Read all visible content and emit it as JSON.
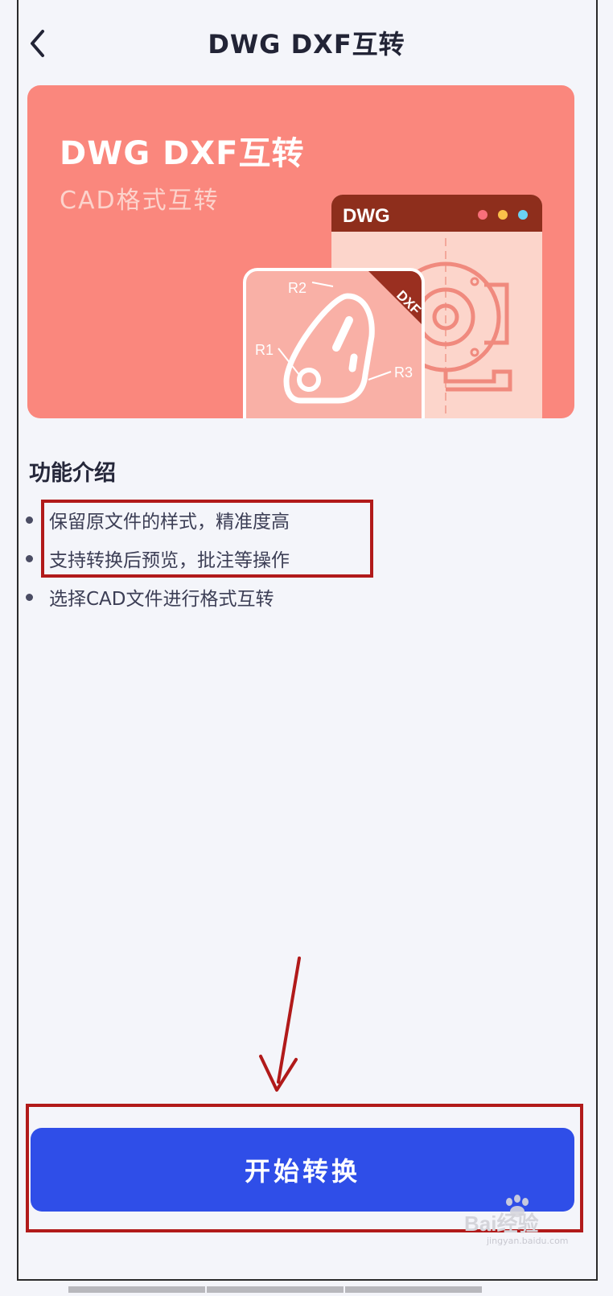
{
  "header": {
    "title": "DWG DXF互转",
    "back_icon": "chevron-left-icon"
  },
  "banner": {
    "title": "DWG DXF互转",
    "subtitle": "CAD格式互转",
    "window_label": "DWG",
    "card_badge": "DXF",
    "labels": [
      "R1",
      "R2",
      "R3"
    ],
    "colors": {
      "background": "#fa877d",
      "window_bar": "#8e2e1c",
      "dots": [
        "#f86f7a",
        "#fbc04a",
        "#6bd1f2"
      ]
    }
  },
  "features": {
    "title": "功能介绍",
    "items": [
      "保留原文件的样式，精准度高",
      "支持转换后预览，批注等操作",
      "选择CAD文件进行格式互转"
    ]
  },
  "start_button": {
    "label": "开始转换",
    "color": "#2f4ee8"
  },
  "annotation_color": "#b11a1a",
  "watermark": {
    "text": "Bai经验",
    "subtext": "jingyan.baidu.com"
  }
}
